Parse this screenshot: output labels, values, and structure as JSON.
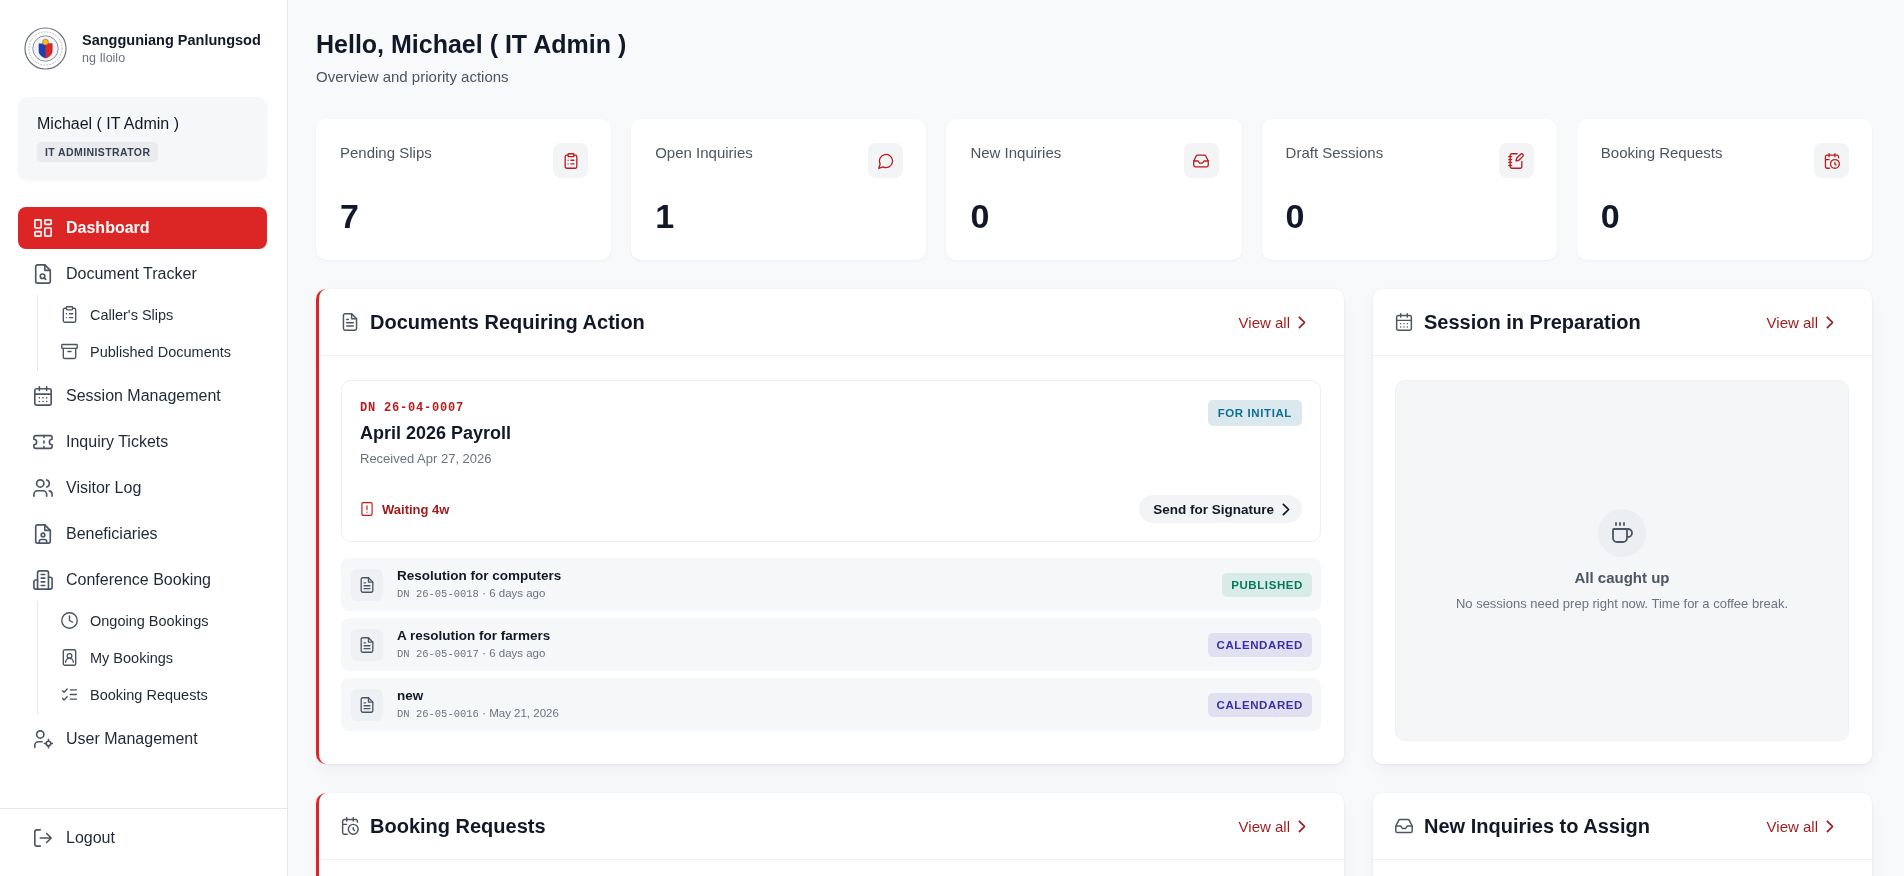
{
  "sidebar": {
    "brand": {
      "title": "Sangguniang Panlungsod",
      "subtitle": "ng Iloilo"
    },
    "user": {
      "name": "Michael ( IT Admin )",
      "role": "IT ADMINISTRATOR"
    },
    "items": [
      {
        "label": "Dashboard",
        "selected": true
      },
      {
        "label": "Document Tracker",
        "selected": false,
        "children": [
          {
            "label": "Caller's Slips",
            "selected": false
          },
          {
            "label": "Published Documents",
            "selected": false
          }
        ]
      },
      {
        "label": "Session Management",
        "selected": false
      },
      {
        "label": "Inquiry Tickets",
        "selected": false
      },
      {
        "label": "Visitor Log",
        "selected": false
      },
      {
        "label": "Beneficiaries",
        "selected": false
      },
      {
        "label": "Conference Booking",
        "selected": false,
        "children": [
          {
            "label": "Ongoing Bookings",
            "selected": false
          },
          {
            "label": "My Bookings",
            "selected": false
          },
          {
            "label": "Booking Requests",
            "selected": false
          }
        ]
      },
      {
        "label": "User Management",
        "selected": false
      }
    ],
    "logout": "Logout"
  },
  "header": {
    "title": "Hello, Michael ( IT Admin )",
    "subtitle": "Overview and priority actions"
  },
  "stats": [
    {
      "label": "Pending Slips",
      "value": "7"
    },
    {
      "label": "Open Inquiries",
      "value": "1"
    },
    {
      "label": "New Inquiries",
      "value": "0"
    },
    {
      "label": "Draft Sessions",
      "value": "0"
    },
    {
      "label": "Booking Requests",
      "value": "0"
    }
  ],
  "panels": [
    {
      "title": "Documents Requiring Action",
      "link": "View all",
      "priority": true,
      "featured": {
        "dn": "DN 26-04-0007",
        "title": "April 2026 Payroll",
        "received": "Received Apr 27, 2026",
        "waiting": "Waiting 4w",
        "action": "Send for Signature",
        "badge": {
          "label": "FOR INITIAL",
          "color": "#0e6f94"
        }
      },
      "rows": [
        {
          "title": "Resolution for computers",
          "dn": "DN 26-05-0018",
          "age": "· 6 days ago",
          "badge": {
            "label": "PUBLISHED",
            "color": "#047857"
          }
        },
        {
          "title": "A resolution for farmers",
          "dn": "DN 26-05-0017",
          "age": "· 6 days ago",
          "badge": {
            "label": "CALENDARED",
            "color": "#3730a3"
          }
        },
        {
          "title": "new",
          "dn": "DN 26-05-0016",
          "age": "· May 21, 2026",
          "badge": {
            "label": "CALENDARED",
            "color": "#3730a3"
          }
        }
      ]
    },
    {
      "title": "Session in Preparation",
      "link": "View all",
      "priority": false,
      "empty": {
        "title": "All caught up",
        "text": "No sessions need prep right now. Time for a coffee break."
      }
    },
    {
      "title": "Booking Requests",
      "link": "View all",
      "priority": true
    },
    {
      "title": "New Inquiries to Assign",
      "link": "View all",
      "priority": false
    }
  ]
}
